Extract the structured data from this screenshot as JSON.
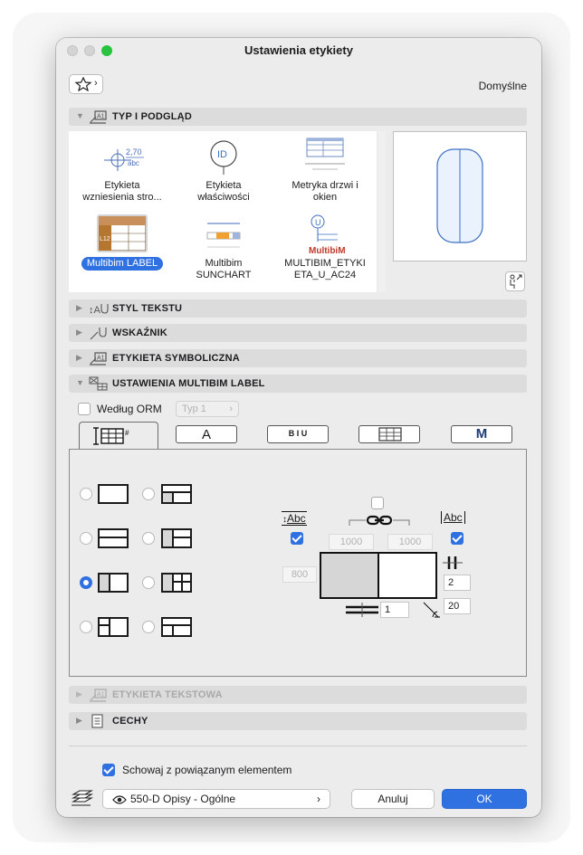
{
  "window": {
    "title": "Ustawienia etykiety"
  },
  "header": {
    "favorites_arrow": "›",
    "default_label": "Domyślne"
  },
  "sections": {
    "type_preview": "TYP I PODGLĄD",
    "text_style": "STYL TEKSTU",
    "pointer": "WSKAŹNIK",
    "symbol_label": "ETYKIETA SYMBOLICZNA",
    "multibim_settings": "USTAWIENIA MULTIBIM LABEL",
    "text_label": "ETYKIETA TEKSTOWA",
    "attributes": "CECHY"
  },
  "label_types": [
    {
      "line1": "Etykieta",
      "line2": "wzniesienia stro...",
      "icon_text_top": "2,70",
      "icon_text_bottom": "abc"
    },
    {
      "line1": "Etykieta",
      "line2": "właściwości",
      "icon_text_top": "ID",
      "icon_text_bottom": ""
    },
    {
      "line1": "Metryka drzwi i",
      "line2": "okien",
      "icon_text_top": "",
      "icon_text_bottom": ""
    },
    {
      "line1": "Multibim LABEL",
      "line2": "",
      "icon_text_top": "L12",
      "icon_text_bottom": "",
      "selected": true
    },
    {
      "line1": "Multibim",
      "line2": "SUNCHART",
      "icon_text_top": "",
      "icon_text_bottom": ""
    },
    {
      "line1": "MULTIBIM_ETYKI",
      "line2": "ETA_U_AC24",
      "icon_text_top": "U",
      "icon_text_bottom": "MultibiM"
    }
  ],
  "multibim": {
    "by_orm_label": "Według ORM",
    "by_orm_checked": false,
    "type_popup": "Typ 1",
    "type_popup_arrow": "›",
    "tabs": [
      "table-layout",
      "A",
      "B I U",
      "grid",
      "M"
    ],
    "tab_font_label": "A",
    "tab_style_label": "B I U",
    "tab_m_label": "M",
    "active_tab": 0,
    "layout_options_selected": 4,
    "abc_left_label": "Abc",
    "abc_right_label": "Abc",
    "abc_left_checked": true,
    "abc_right_checked": true,
    "link_checked": false,
    "width_left": "1000",
    "width_right": "1000",
    "height": "800",
    "columns": "2",
    "rows": "1",
    "angle": "20"
  },
  "footer": {
    "hide_label": "Schowaj z powiązanym elementem",
    "hide_checked": true,
    "layer_popup": "550-D Opisy - Ogólne",
    "layer_arrow": "›",
    "cancel_label": "Anuluj",
    "ok_label": "OK"
  },
  "colors": {
    "accent": "#2f71e0",
    "section_bg": "#dcdcdc",
    "window_bg": "#ececec"
  }
}
